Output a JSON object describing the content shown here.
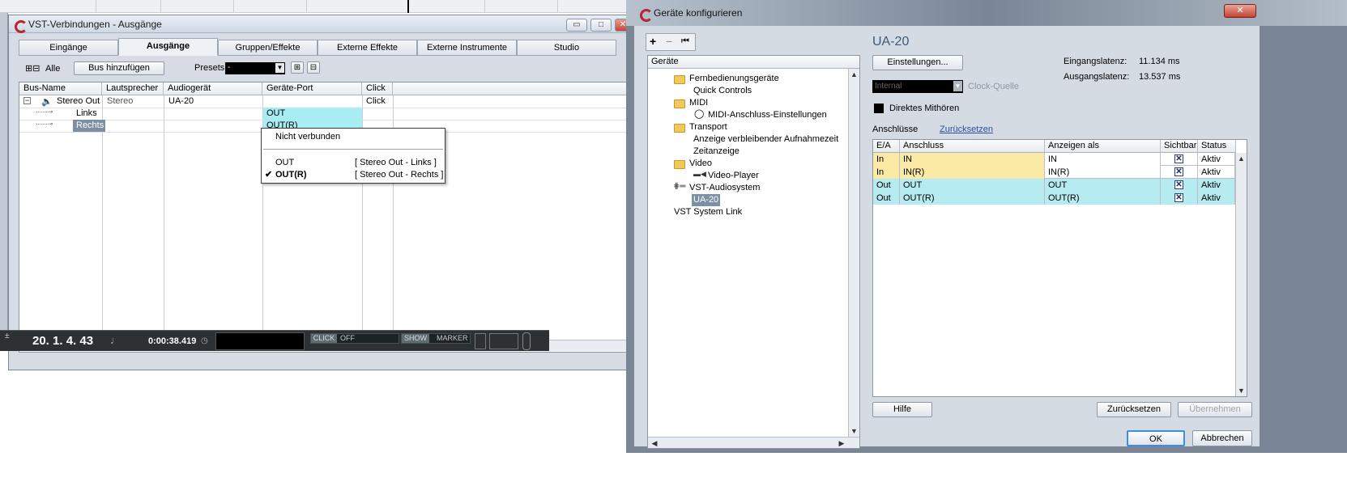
{
  "background": {
    "accent": "#d6dbe4"
  },
  "vst_window": {
    "title": "VST-Verbindungen - Ausgänge",
    "controls": {
      "minimize": "▭",
      "maximize": "□",
      "close": "✕"
    },
    "tabs": [
      "Eingänge",
      "Ausgänge",
      "Gruppen/Effekte",
      "Externe Effekte",
      "Externe Instrumente",
      "Studio"
    ],
    "active_tab": "Ausgänge",
    "toolbar": {
      "all_label": "Alle",
      "add_bus_label": "Bus hinzufügen",
      "presets_label": "Presets",
      "presets_value": "-"
    },
    "columns": [
      "Bus-Name",
      "Lautsprecher",
      "Audiogerät",
      "Geräte-Port",
      "Click"
    ],
    "rows": [
      {
        "bus": "Stereo Out",
        "speaker": "Stereo",
        "device": "UA-20",
        "port": "",
        "click": "Click"
      },
      {
        "bus": "Links",
        "speaker": "",
        "device": "",
        "port": "OUT",
        "click": ""
      },
      {
        "bus": "Rechts",
        "speaker": "",
        "device": "",
        "port": "OUT(R)",
        "click": ""
      }
    ],
    "context_menu": {
      "none": "Nicht verbunden",
      "items": [
        {
          "label": "OUT",
          "target": "[ Stereo Out - Links ]",
          "checked": false
        },
        {
          "label": "OUT(R)",
          "target": "[ Stereo Out - Rechts ]",
          "checked": true
        }
      ]
    }
  },
  "transport": {
    "position": "20. 1. 4. 43",
    "time": "0:00:38.419",
    "click_label": "CLICK",
    "click_value": "OFF",
    "show_label": "SHOW",
    "marker_label": "MARKER"
  },
  "devices_dialog": {
    "title": "Geräte konfigurieren",
    "close_glyph": "✕",
    "tree_toolbar": {
      "add": "+",
      "remove": "−",
      "reset": "⏮"
    },
    "tree_header": "Geräte",
    "tree": [
      {
        "label": "Fernbedienungsgeräte",
        "level": 1,
        "icon": "folder"
      },
      {
        "label": "Quick Controls",
        "level": 2,
        "icon": "none"
      },
      {
        "label": "MIDI",
        "level": 1,
        "icon": "folder"
      },
      {
        "label": "MIDI-Anschluss-Einstellungen",
        "level": 2,
        "icon": "midi-port"
      },
      {
        "label": "Transport",
        "level": 1,
        "icon": "folder"
      },
      {
        "label": "Anzeige verbleibender Aufnahmezeit",
        "level": 2,
        "icon": "none"
      },
      {
        "label": "Zeitanzeige",
        "level": 2,
        "icon": "none"
      },
      {
        "label": "Video",
        "level": 1,
        "icon": "folder"
      },
      {
        "label": "Video-Player",
        "level": 2,
        "icon": "video"
      },
      {
        "label": "VST-Audiosystem",
        "level": 1,
        "icon": "audio"
      },
      {
        "label": "UA-20",
        "level": 2,
        "icon": "none",
        "selected": true
      },
      {
        "label": "VST System Link",
        "level": 1,
        "icon": "none"
      }
    ],
    "device_name": "UA-20",
    "settings_button": "Einstellungen...",
    "input_latency_label": "Eingangslatenz:",
    "input_latency_value": "11.134 ms",
    "output_latency_label": "Ausgangslatenz:",
    "output_latency_value": "13.537 ms",
    "clock_value": "Internal",
    "clock_label": "Clock-Quelle",
    "direct_monitoring_label": "Direktes Mithören",
    "ports_label": "Anschlüsse",
    "reset_link": "Zurücksetzen",
    "table_columns": [
      "E/A",
      "Anschluss",
      "Anzeigen als",
      "Sichtbar",
      "Status"
    ],
    "table_rows": [
      {
        "io": "In",
        "port": "IN",
        "display": "IN",
        "visible": true,
        "status": "Aktiv"
      },
      {
        "io": "In",
        "port": "IN(R)",
        "display": "IN(R)",
        "visible": true,
        "status": "Aktiv"
      },
      {
        "io": "Out",
        "port": "OUT",
        "display": "OUT",
        "visible": true,
        "status": "Aktiv"
      },
      {
        "io": "Out",
        "port": "OUT(R)",
        "display": "OUT(R)",
        "visible": true,
        "status": "Aktiv"
      }
    ],
    "help_button": "Hilfe",
    "reset_button": "Zurücksetzen",
    "apply_button": "Übernehmen",
    "ok_button": "OK",
    "cancel_button": "Abbrechen"
  }
}
